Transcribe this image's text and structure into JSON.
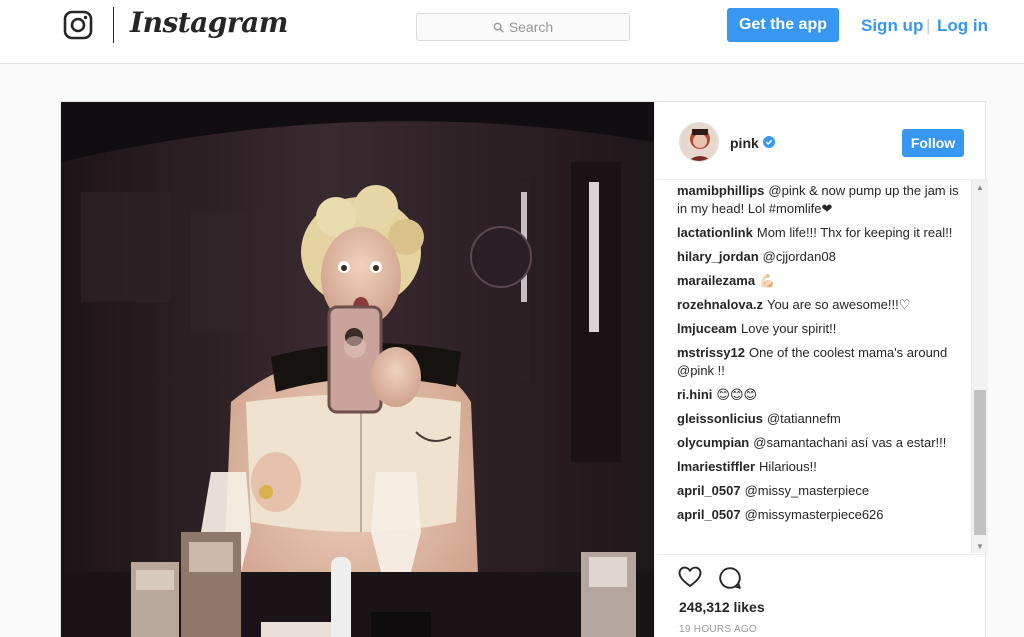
{
  "nav": {
    "wordmark": "Instagram",
    "search_placeholder": "Search",
    "get_app_label": "Get the app",
    "signup_label": "Sign up",
    "separator": "|",
    "login_label": "Log in"
  },
  "post": {
    "username": "pink",
    "follow_label": "Follow",
    "likes": "248,312 likes",
    "timestamp": "19 HOURS AGO"
  },
  "comments": [
    {
      "user": "mamibphillips",
      "text": "@pink & now pump up the jam is in my head! Lol #momlife❤"
    },
    {
      "user": "lactationlink",
      "text": "Mom life!!! Thx for keeping it real!!"
    },
    {
      "user": "hilary_jordan",
      "text": "@cjjordan08"
    },
    {
      "user": "marailezama",
      "text": "💪🏻"
    },
    {
      "user": "rozehnalova.z",
      "text": "You are so awesome!!!♡"
    },
    {
      "user": "lmjuceam",
      "text": "Love your spirit!!"
    },
    {
      "user": "mstrissy12",
      "text": "One of the coolest mama's around @pink !!"
    },
    {
      "user": "ri.hini",
      "text": "😊😊😊"
    },
    {
      "user": "gleissonlicius",
      "text": "@tatiannefm"
    },
    {
      "user": "olycumpian",
      "text": "@samantachani así vas a estar!!!"
    },
    {
      "user": "lmariestiffler",
      "text": "Hilarious!!"
    },
    {
      "user": "april_0507",
      "text": "@missy_masterpiece"
    },
    {
      "user": "april_0507",
      "text": "@missymasterpiece626"
    }
  ],
  "colors": {
    "accent": "#3897f0",
    "text": "#262626",
    "muted": "#999999"
  },
  "icons": [
    "instagram-camera-icon",
    "search-icon",
    "verified-badge-icon",
    "heart-icon",
    "comment-icon"
  ]
}
